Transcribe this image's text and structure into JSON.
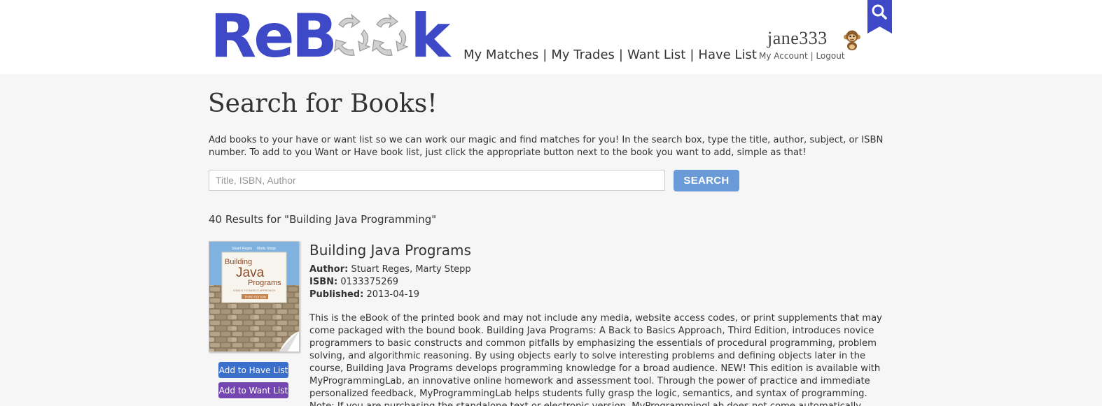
{
  "header": {
    "logo": {
      "text_left": "ReB",
      "text_right": "k",
      "alt": "ReBook"
    },
    "nav": [
      {
        "label": "My Matches"
      },
      {
        "label": "My Trades"
      },
      {
        "label": "Want List"
      },
      {
        "label": "Have List"
      }
    ],
    "nav_separator": "|",
    "user": {
      "username": "jane333",
      "avatar_icon": "monkey-icon",
      "my_account": "My Account",
      "separator": "|",
      "logout": "Logout"
    },
    "search_icon": "search-icon"
  },
  "main": {
    "title": "Search for Books!",
    "intro": "Add books to your have or want list so we can work our magic and find matches for you! In the search box, type the title, author, subject, or ISBN number. To add to you Want or Have book list, just click the appropriate button next to the book you want to add, simple as that!",
    "search": {
      "placeholder": "Title, ISBN, Author",
      "value": "",
      "button": "SEARCH"
    },
    "results_count": "40 Results for \"Building Java Programming\""
  },
  "results": [
    {
      "title": "Building Java Programs",
      "author_label": "Author:",
      "author": "Stuart Reges, Marty Stepp",
      "isbn_label": "ISBN:",
      "isbn": "0133375269",
      "published_label": "Published:",
      "published": "2013-04-19",
      "cover": {
        "author1": "Stuart Reges",
        "author2": "Marty Stepp",
        "line1": "Building",
        "line2": "Java",
        "line3": "Programs",
        "subtitle": "A BACK TO BASICS APPROACH",
        "edition": "THIRD EDITION"
      },
      "add_have": "Add to Have List",
      "add_want": "Add to Want List",
      "description": "This is the eBook of the printed book and may not include any media, website access codes, or print supplements that may come packaged with the bound book. Building Java Programs: A Back to Basics Approach, Third Edition, introduces novice programmers to basic constructs and common pitfalls by emphasizing the essentials of procedural programming, problem solving, and algorithmic reasoning. By using objects early to solve interesting problems and defining objects later in the course, Building Java Programs develops programming knowledge for a broad audience. NEW! This edition is available with MyProgrammingLab, an innovative online homework and assessment tool. Through the power of practice and immediate personalized feedback, MyProgrammingLab helps students fully grasp the logic, semantics, and syntax of programming. Note: If you are purchasing the standalone text or electronic version, MyProgrammingLab does not come automatically packaged with the text. To purchase MyProgrammingLab, please visit www.myprogramminglab.com or you can purchase a package of the physical text + MyProgrammingLab by searching the"
    }
  ],
  "colors": {
    "logo_blue": "#3e49c8",
    "logo_gray": "#c4c4c4",
    "bookmark_blue": "#3e49c8",
    "search_button": "#6a9bd8",
    "have_button": "#3a6fcc",
    "want_button": "#7446b0",
    "page_bg": "#f6f6f6"
  }
}
